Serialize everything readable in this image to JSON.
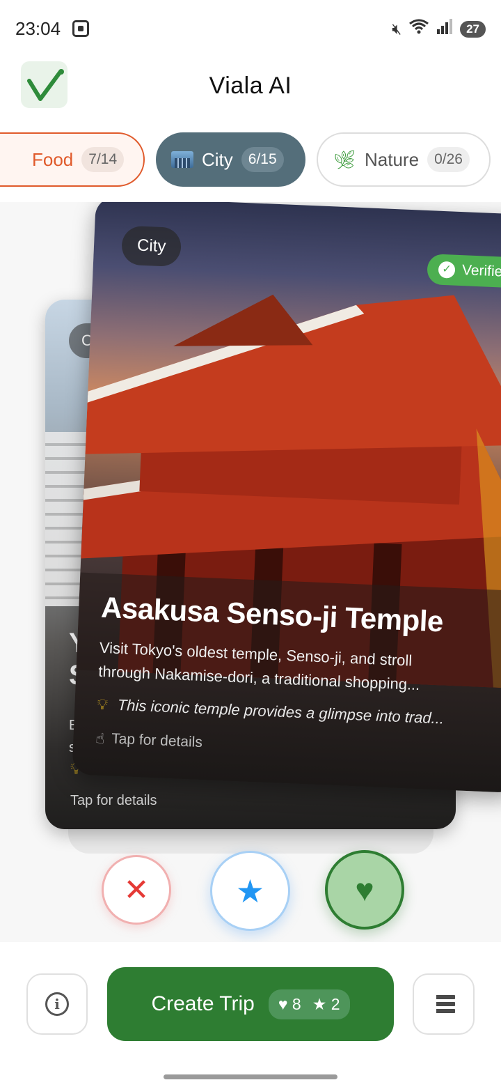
{
  "status_bar": {
    "time": "23:04",
    "battery": "27",
    "icons": [
      "screen-record-icon",
      "mute-icon",
      "wifi-icon",
      "signal-icon",
      "battery-icon"
    ]
  },
  "header": {
    "logo": "checkmark-logo",
    "title": "Viala AI"
  },
  "categories": [
    {
      "label": "Food",
      "count": "7/14",
      "selected": false,
      "accent": "#e05a2b"
    },
    {
      "label": "City",
      "count": "6/15",
      "selected": true,
      "accent": "#546e7a",
      "icon": "city-icon"
    },
    {
      "label": "Nature",
      "count": "0/26",
      "selected": false,
      "icon": "leaf-icon"
    }
  ],
  "cards": {
    "front": {
      "tag": "City",
      "badge": "Verified",
      "title": "Asakusa Senso-ji Temple",
      "description_1": "Visit Tokyo's oldest temple, Senso-ji, and stroll",
      "description_2": "through Nakamise-dori, a traditional shopping...",
      "tip": "This iconic temple provides a glimpse into trad...",
      "tap_hint": "Tap for details"
    },
    "back": {
      "tag": "City",
      "title_line_1": "Ya",
      "title_line_2": "St",
      "desc_1": "Ex",
      "desc_2": "sh",
      "tap_hint": "Tap for details"
    }
  },
  "actions": {
    "dislike_icon": "close-icon",
    "superlike_icon": "star-icon",
    "like_icon": "heart-icon"
  },
  "bottom_bar": {
    "info_icon": "info-icon",
    "create_trip_label": "Create Trip",
    "likes_count": "8",
    "stars_count": "2",
    "list_icon": "list-icon"
  },
  "colors": {
    "primary_green": "#2e7d32",
    "city_chip": "#546e7a",
    "food_accent": "#e05a2b",
    "verified_green": "#4caf50",
    "dislike_red": "#e53935",
    "star_blue": "#2196f3"
  }
}
